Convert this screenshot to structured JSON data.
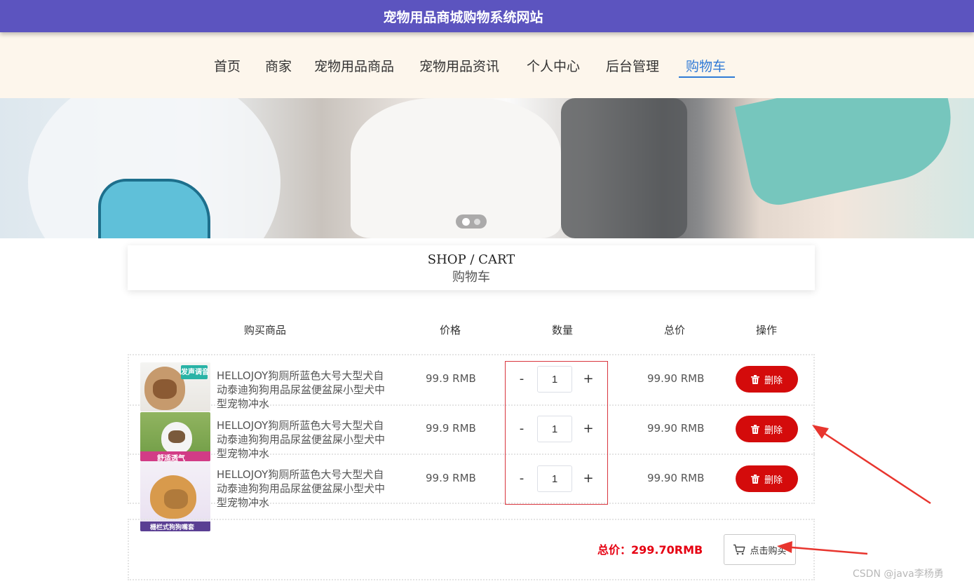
{
  "site": {
    "title": "宠物用品商城购物系统网站"
  },
  "nav": {
    "items": [
      "首页",
      "商家",
      "宠物用品商品",
      "宠物用品资讯",
      "个人中心",
      "后台管理",
      "购物车"
    ],
    "active": "购物车"
  },
  "colors": {
    "header": "#5c54bf",
    "nav_bg": "#fdf6ec",
    "active": "#2f7ad6",
    "danger": "#d40b0b",
    "total": "#e60012"
  },
  "carousel": {
    "slides": 2,
    "current": 1
  },
  "section": {
    "title_en": "SHOP / CART",
    "title_cn": "购物车"
  },
  "table": {
    "headers": [
      "购买商品",
      "价格",
      "数量",
      "总价",
      "操作"
    ],
    "rows": [
      {
        "name": "HELLOJOY狗厕所蓝色大号大型犬自动泰迪狗狗用品尿盆便盆屎小型犬中型宠物冲水",
        "price": "99.9 RMB",
        "qty": "1",
        "total": "99.90 RMB",
        "action": "删除",
        "image_tags": [
          "发声调音"
        ]
      },
      {
        "name": "HELLOJOY狗厕所蓝色大号大型犬自动泰迪狗狗用品尿盆便盆屎小型犬中型宠物冲水",
        "price": "99.9 RMB",
        "qty": "1",
        "total": "99.90 RMB",
        "action": "删除",
        "image_tags": [
          "舒适透气"
        ]
      },
      {
        "name": "HELLOJOY狗厕所蓝色大号大型犬自动泰迪狗狗用品尿盆便盆屎小型犬中型宠物冲水",
        "price": "99.9 RMB",
        "qty": "1",
        "total": "99.90 RMB",
        "action": "删除",
        "image_tags": [
          "栅栏式狗狗嘴套"
        ]
      }
    ],
    "minus_label": "-",
    "plus_label": "+"
  },
  "summary": {
    "total_label": "总价：299.70RMB",
    "buy_label": "点击购买"
  },
  "icons": {
    "delete": "trash-icon",
    "buy": "cart-icon"
  },
  "watermark": "CSDN @java李杨勇"
}
